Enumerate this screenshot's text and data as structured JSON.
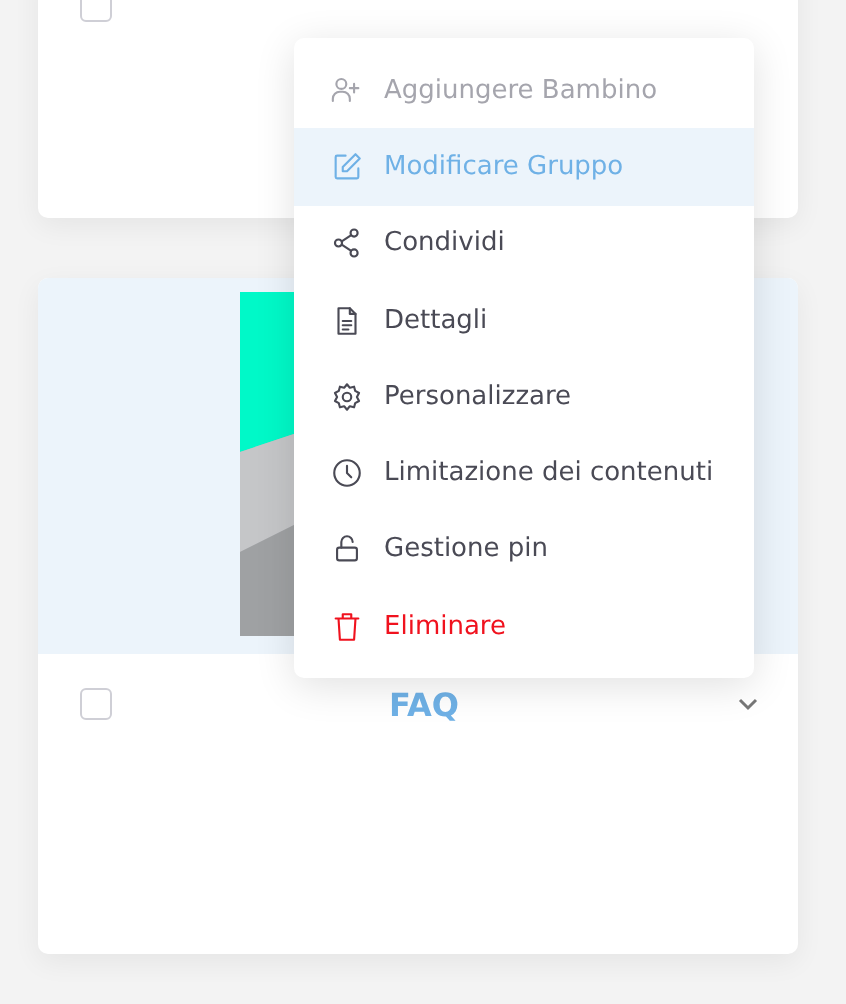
{
  "cards": [
    {
      "checked": false
    },
    {
      "title": "FAQ",
      "checked": false,
      "expanded": false
    }
  ],
  "menu": {
    "items": [
      {
        "label": "Aggiungere Bambino",
        "kind": "action",
        "disabled": true,
        "selected": false
      },
      {
        "label": "Modificare Gruppo",
        "kind": "action",
        "disabled": false,
        "selected": true
      },
      {
        "label": "Condividi",
        "kind": "action",
        "disabled": false,
        "selected": false
      },
      {
        "label": "Dettagli",
        "kind": "action",
        "disabled": false,
        "selected": false
      },
      {
        "label": "Personalizzare",
        "kind": "action",
        "disabled": false,
        "selected": false
      },
      {
        "label": "Limitazione dei contenuti",
        "kind": "action",
        "disabled": false,
        "selected": false
      },
      {
        "label": "Gestione pin",
        "kind": "action",
        "disabled": false,
        "selected": false
      },
      {
        "label": "Eliminare",
        "kind": "danger",
        "disabled": false,
        "selected": false
      }
    ]
  }
}
